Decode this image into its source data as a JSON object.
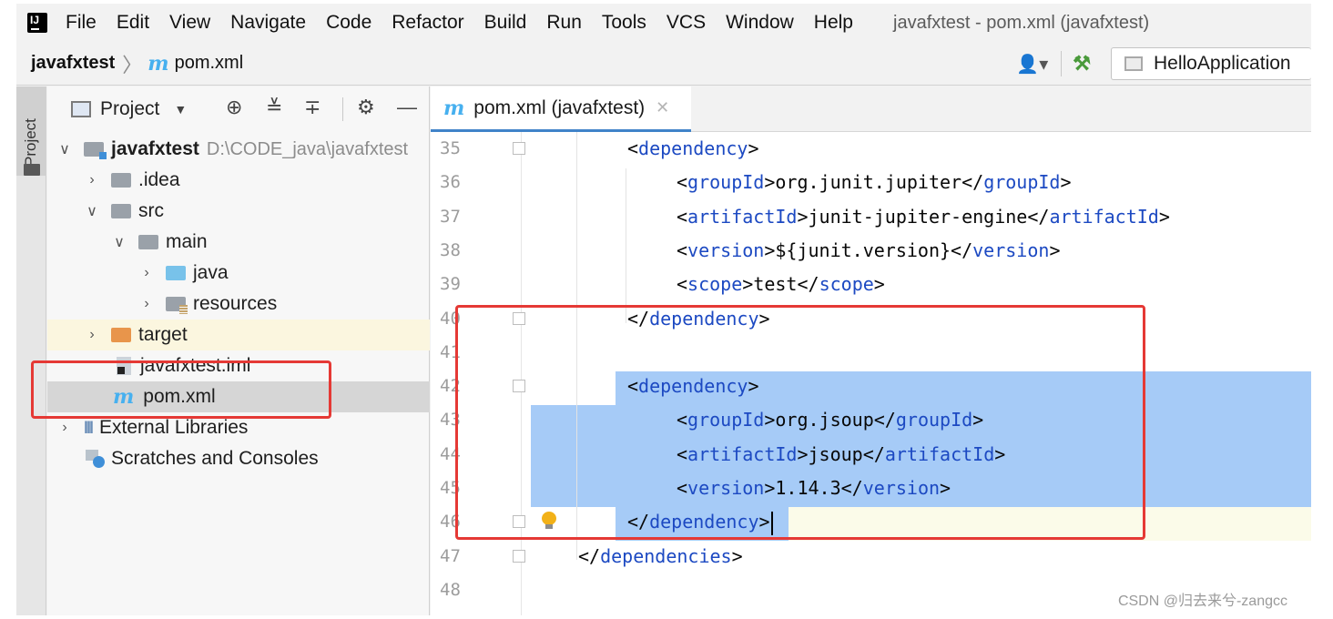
{
  "menu": {
    "items": [
      "File",
      "Edit",
      "View",
      "Navigate",
      "Code",
      "Refactor",
      "Build",
      "Run",
      "Tools",
      "VCS",
      "Window",
      "Help"
    ],
    "window_title": "javafxtest - pom.xml (javafxtest)"
  },
  "navbar": {
    "project": "javafxtest",
    "file": "pom.xml",
    "run_config": "HelloApplication"
  },
  "side_strip": {
    "tab_label": "Project"
  },
  "project_panel": {
    "header_label": "Project",
    "tree": [
      {
        "label": "javafxtest",
        "path": "D:\\CODE_java\\javafxtest"
      },
      {
        "label": ".idea"
      },
      {
        "label": "src"
      },
      {
        "label": "main"
      },
      {
        "label": "java"
      },
      {
        "label": "resources"
      },
      {
        "label": "target"
      },
      {
        "label": "javafxtest.iml"
      },
      {
        "label": "pom.xml"
      },
      {
        "label": "External Libraries"
      },
      {
        "label": "Scratches and Consoles"
      }
    ]
  },
  "editor": {
    "tab_label": "pom.xml (javafxtest)",
    "lines": [
      {
        "no": "35",
        "open": "<",
        "tag": "dependency",
        "close": ">",
        "text": "",
        "tag2": "",
        "end": ""
      },
      {
        "no": "36",
        "open": "<",
        "tag": "groupId",
        "close": ">",
        "text": "org.junit.jupiter",
        "tag2": "groupId",
        "end": ">"
      },
      {
        "no": "37",
        "open": "<",
        "tag": "artifactId",
        "close": ">",
        "text": "junit-jupiter-engine",
        "tag2": "artifactId",
        "end": ">"
      },
      {
        "no": "38",
        "open": "<",
        "tag": "version",
        "close": ">",
        "text": "${junit.version}",
        "tag2": "version",
        "end": ">"
      },
      {
        "no": "39",
        "open": "<",
        "tag": "scope",
        "close": ">",
        "text": "test",
        "tag2": "scope",
        "end": ">"
      },
      {
        "no": "40",
        "open": "</",
        "tag": "dependency",
        "close": ">",
        "text": "",
        "tag2": "",
        "end": ""
      },
      {
        "no": "41",
        "open": "",
        "tag": "",
        "close": "",
        "text": "",
        "tag2": "",
        "end": ""
      },
      {
        "no": "42",
        "open": "<",
        "tag": "dependency",
        "close": ">",
        "text": "",
        "tag2": "",
        "end": ""
      },
      {
        "no": "43",
        "open": "<",
        "tag": "groupId",
        "close": ">",
        "text": "org.jsoup",
        "tag2": "groupId",
        "end": ">"
      },
      {
        "no": "44",
        "open": "<",
        "tag": "artifactId",
        "close": ">",
        "text": "jsoup",
        "tag2": "artifactId",
        "end": ">"
      },
      {
        "no": "45",
        "open": "<",
        "tag": "version",
        "close": ">",
        "text": "1.14.3",
        "tag2": "version",
        "end": ">"
      },
      {
        "no": "46",
        "open": "</",
        "tag": "dependency",
        "close": ">",
        "text": "",
        "tag2": "",
        "end": ""
      },
      {
        "no": "47",
        "open": "</",
        "tag": "dependencies",
        "close": ">",
        "text": "",
        "tag2": "",
        "end": ""
      },
      {
        "no": "48",
        "open": "",
        "tag": "",
        "close": "",
        "text": "",
        "tag2": "",
        "end": ""
      }
    ]
  },
  "watermark": "CSDN @归去来兮-zangcc",
  "colors": {
    "tag": "#1c49c2",
    "selection": "#a6cbf7",
    "annotation": "#e53935"
  }
}
